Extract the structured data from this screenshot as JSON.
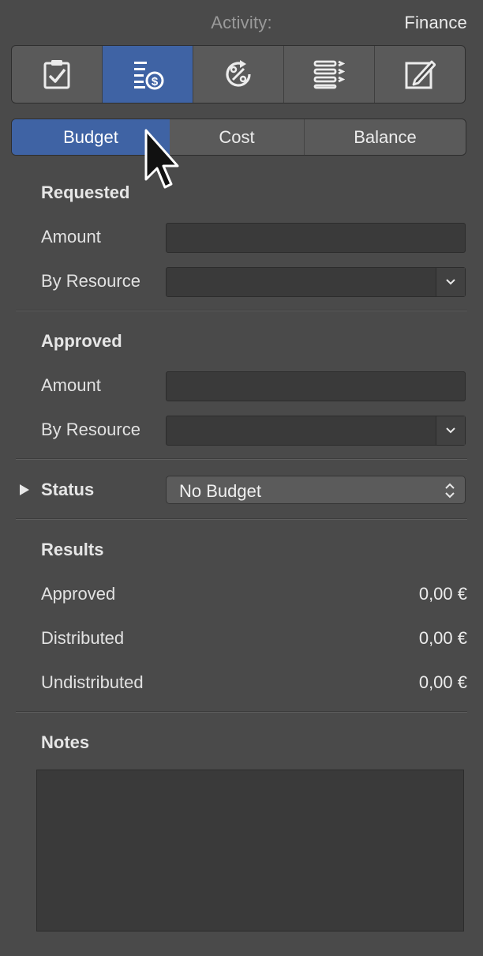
{
  "header": {
    "label": "Activity:",
    "value": "Finance"
  },
  "toolbar": {
    "icons": [
      "clipboard-check-icon",
      "budget-list-icon",
      "percent-cycle-icon",
      "list-tags-icon",
      "edit-note-icon"
    ],
    "active_index": 1
  },
  "segmented": {
    "tabs": [
      "Budget",
      "Cost",
      "Balance"
    ],
    "selected": "Budget"
  },
  "requested": {
    "title": "Requested",
    "amount_label": "Amount",
    "amount_value": "",
    "by_resource_label": "By Resource",
    "by_resource_value": ""
  },
  "approved": {
    "title": "Approved",
    "amount_label": "Amount",
    "amount_value": "",
    "by_resource_label": "By Resource",
    "by_resource_value": ""
  },
  "status": {
    "label": "Status",
    "value": "No Budget"
  },
  "results": {
    "title": "Results",
    "rows": [
      {
        "label": "Approved",
        "value": "0,00 €"
      },
      {
        "label": "Distributed",
        "value": "0,00 €"
      },
      {
        "label": "Undistributed",
        "value": "0,00 €"
      }
    ]
  },
  "notes": {
    "title": "Notes",
    "value": ""
  },
  "colors": {
    "accent": "#3f63a4",
    "background": "#4a4a4a",
    "field": "#3a3a3a"
  }
}
